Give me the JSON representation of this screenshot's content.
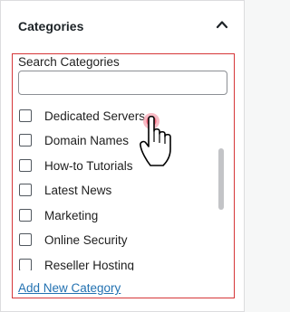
{
  "header": {
    "title": "Categories"
  },
  "search": {
    "label": "Search Categories",
    "value": "",
    "placeholder": ""
  },
  "categories": [
    {
      "label": "Dedicated Servers",
      "checked": false
    },
    {
      "label": "Domain Names",
      "checked": false
    },
    {
      "label": "How-to Tutorials",
      "checked": false
    },
    {
      "label": "Latest News",
      "checked": false
    },
    {
      "label": "Marketing",
      "checked": false
    },
    {
      "label": "Online Security",
      "checked": false
    },
    {
      "label": "Reseller Hosting",
      "checked": false
    }
  ],
  "footer": {
    "add_new_label": "Add New Category"
  },
  "icons": {
    "toggle": "chevron-up-icon",
    "cursor": "hand-pointer-icon"
  },
  "colors": {
    "highlight_border": "#d63638",
    "link": "#2271b1",
    "click_indicator": "#f0647a"
  }
}
